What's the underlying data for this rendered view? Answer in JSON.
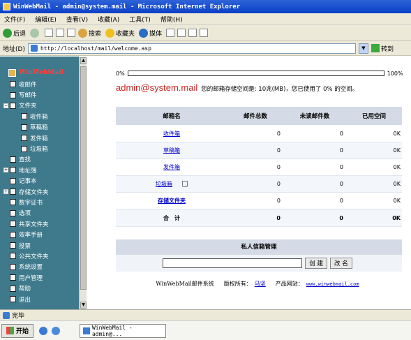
{
  "window": {
    "title": "WinWebMail - admin@system.mail - Microsoft Internet Explorer"
  },
  "menu": [
    "文件(F)",
    "编辑(E)",
    "查看(V)",
    "收藏(A)",
    "工具(T)",
    "帮助(H)"
  ],
  "toolbar": {
    "back": "后退",
    "search": "搜索",
    "favorites": "收藏夹",
    "media": "媒体"
  },
  "address": {
    "label": "地址(D)",
    "url": "http://localhost/mail/welcome.asp",
    "go": "转到"
  },
  "sidebar": {
    "logo": "WinWebMail",
    "items": [
      {
        "label": "收邮件",
        "level": 1
      },
      {
        "label": "写邮件",
        "level": 1
      },
      {
        "label": "文件夹",
        "level": 1,
        "expander": "−"
      },
      {
        "label": "收件箱",
        "level": 2
      },
      {
        "label": "草稿箱",
        "level": 2
      },
      {
        "label": "发件箱",
        "level": 2
      },
      {
        "label": "垃圾箱",
        "level": 2
      },
      {
        "label": "查找",
        "level": 1
      },
      {
        "label": "地址簿",
        "level": 1,
        "expander": "+"
      },
      {
        "label": "记事本",
        "level": 1
      },
      {
        "label": "存储文件夹",
        "level": 1,
        "expander": "+"
      },
      {
        "label": "数字证书",
        "level": 1
      },
      {
        "label": "选项",
        "level": 1
      },
      {
        "label": "共享文件夹",
        "level": 1
      },
      {
        "label": "效率手册",
        "level": 1
      },
      {
        "label": "投票",
        "level": 1
      },
      {
        "label": "公共文件夹",
        "level": 1
      },
      {
        "label": "系统设置",
        "level": 1
      },
      {
        "label": "用户管理",
        "level": 1
      },
      {
        "label": "帮助",
        "level": 1
      },
      {
        "label": "退出",
        "level": 1
      }
    ]
  },
  "quota": {
    "min_label": "0%",
    "max_label": "100%",
    "used_fraction": 0,
    "user": "admin@system.mail",
    "text": "您的邮箱存储空间是: 10兆(MB)，您已使用了 0% 的空间。"
  },
  "mail_table": {
    "headers": [
      "邮箱名",
      "邮件总数",
      "未读邮件数",
      "已用空间"
    ],
    "rows": [
      {
        "name": "收件箱",
        "total": "0",
        "unread": "0",
        "size": "0K",
        "style": "link"
      },
      {
        "name": "草稿箱",
        "total": "0",
        "unread": "0",
        "size": "0K",
        "style": "link"
      },
      {
        "name": "发件箱",
        "total": "0",
        "unread": "0",
        "size": "0K",
        "style": "link"
      },
      {
        "name": "垃圾箱",
        "total": "0",
        "unread": "0",
        "size": "0K",
        "style": "link",
        "trash": true
      },
      {
        "name": "存储文件夹",
        "total": "0",
        "unread": "0",
        "size": "0K",
        "style": "link-bold"
      },
      {
        "name": "合　计",
        "total": "0",
        "unread": "0",
        "size": "0K",
        "style": "bold"
      }
    ]
  },
  "private_mailbox": {
    "title": "私人信箱管理",
    "create_label": "创 建",
    "rename_label": "改 名"
  },
  "footer": {
    "system": "WinWebMail邮件系统",
    "copyright_label": "版权所有：",
    "owner": "马坚",
    "site_label": "产品网站：",
    "url": "www.winwebmail.com"
  },
  "status": {
    "text": "完毕"
  },
  "taskbar": {
    "start": "开始",
    "task": "WinWebMail - admin@..."
  }
}
